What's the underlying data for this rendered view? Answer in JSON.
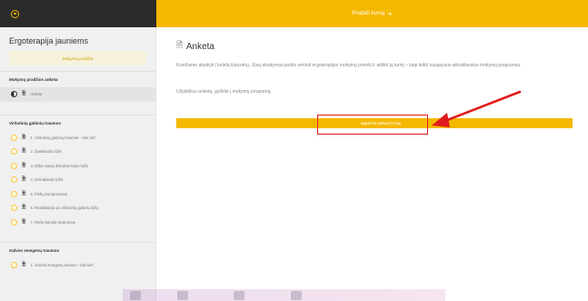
{
  "topbar": {
    "logo_icon": "sun-icon",
    "link_label": "Pradėti kursą",
    "link_icon": "arrow-right-icon"
  },
  "sidebar": {
    "course_title": "Ergoterapija jauniems",
    "progress_text": "Mokymų pradžia",
    "sections": [
      {
        "header": "Mokymų pradžios anketa",
        "items": [
          {
            "label": "Anketa",
            "status": "in-progress",
            "active": true
          }
        ]
      },
      {
        "header": "Viršutinių galūnių traumos",
        "items": [
          {
            "label": "1. Viršutinių galūnių traumos – kas tai?",
            "status": "not-started",
            "active": false
          },
          {
            "label": "2. Žastikaulio lūžis",
            "status": "not-started",
            "active": false
          },
          {
            "label": "3. Dilbio kaulų distalinio kūno lūžis",
            "status": "not-started",
            "active": false
          },
          {
            "label": "4. Delnakaulio lūžis",
            "status": "not-started",
            "active": false
          },
          {
            "label": "5. Pirštų komponentai",
            "status": "not-started",
            "active": false
          },
          {
            "label": "6. Reabilitacija po viršutinių galūnių lūžių",
            "status": "not-started",
            "active": false
          },
          {
            "label": "7. Riešo kanalo sindromas",
            "status": "not-started",
            "active": false
          }
        ]
      },
      {
        "header": "Galvos smegenų traumos",
        "items": [
          {
            "label": "1. Galvos smegenų trauma – kas tai?",
            "status": "not-started",
            "active": false
          }
        ]
      }
    ]
  },
  "main": {
    "title": "Anketa",
    "title_icon": "document-icon",
    "intro": "Kviečiame atsakyti į keletą klausimų. Jūsų atsakymai padės vertinti ergoterapijos mokymų poreikį ir atitikti jų turinį – kaip teikti naujausius aktualiausius mokymų programas.",
    "cta": "Užpildžius anketą, grįžkite į mokymų programą.",
    "start_label": "ANKETOS UŽPILDYTI ČIA"
  },
  "colors": {
    "accent": "#f5b800",
    "dark": "#2b2b2b",
    "highlight": "#e01b1b"
  }
}
